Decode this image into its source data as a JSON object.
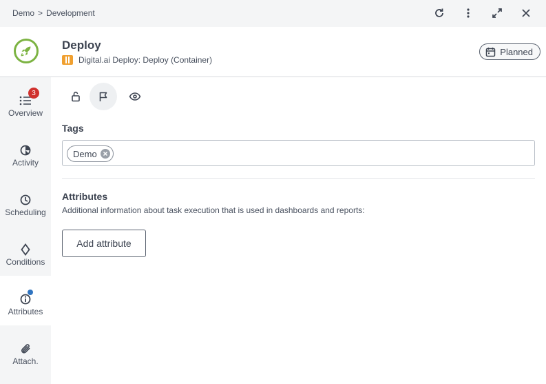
{
  "breadcrumb": {
    "items": [
      "Demo",
      "Development"
    ],
    "separator": ">"
  },
  "topbar": {
    "icons": [
      "refresh-icon",
      "more-vertical-icon",
      "expand-icon",
      "close-icon"
    ]
  },
  "task": {
    "title": "Deploy",
    "type_label": "Digital.ai Deploy: Deploy (Container)",
    "status": "Planned",
    "logo_icon": "rocket-icon"
  },
  "sidebar": {
    "items": [
      {
        "label": "Overview",
        "icon": "list-icon",
        "badge": "3"
      },
      {
        "label": "Activity",
        "icon": "activity-pie-icon"
      },
      {
        "label": "Scheduling",
        "icon": "clock-icon"
      },
      {
        "label": "Conditions",
        "icon": "diamond-icon"
      },
      {
        "label": "Attributes",
        "icon": "info-icon",
        "active": true,
        "indicator": "dot"
      },
      {
        "label": "Attach.",
        "icon": "paperclip-icon"
      }
    ]
  },
  "toolbar": {
    "icons": [
      "unlock-icon",
      "flag-icon",
      "eye-icon"
    ],
    "active": "flag-icon"
  },
  "tags": {
    "title": "Tags",
    "items": [
      "Demo"
    ]
  },
  "attributes": {
    "title": "Attributes",
    "description": "Additional information about task execution that is used in dashboards and reports:",
    "add_label": "Add attribute"
  },
  "colors": {
    "accent_green": "#7cb342",
    "badge_red": "#d0312d",
    "indicator_blue": "#2f74c0",
    "type_orange": "#f0a030"
  }
}
